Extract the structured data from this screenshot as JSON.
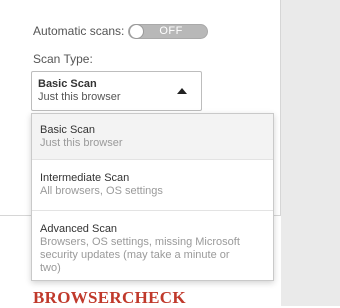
{
  "settings": {
    "automatic_scans_label": "Automatic scans:",
    "automatic_scans_state": "OFF",
    "scan_type_label": "Scan Type:"
  },
  "select": {
    "selected_title": "Basic Scan",
    "selected_subtitle": "Just this browser"
  },
  "options": [
    {
      "title": "Basic Scan",
      "subtitle": "Just this browser"
    },
    {
      "title": "Intermediate Scan",
      "subtitle": "All browsers, OS settings"
    },
    {
      "title": "Advanced Scan",
      "subtitle": "Browsers, OS settings, missing Microsoft security updates (may take a minute or two)"
    }
  ],
  "brand": {
    "logo_text": "BROWSERCHECK"
  },
  "colors": {
    "brand": "#c0392b",
    "toggle_off": "#b8b8b8",
    "highlight": "#f3f3f3"
  }
}
